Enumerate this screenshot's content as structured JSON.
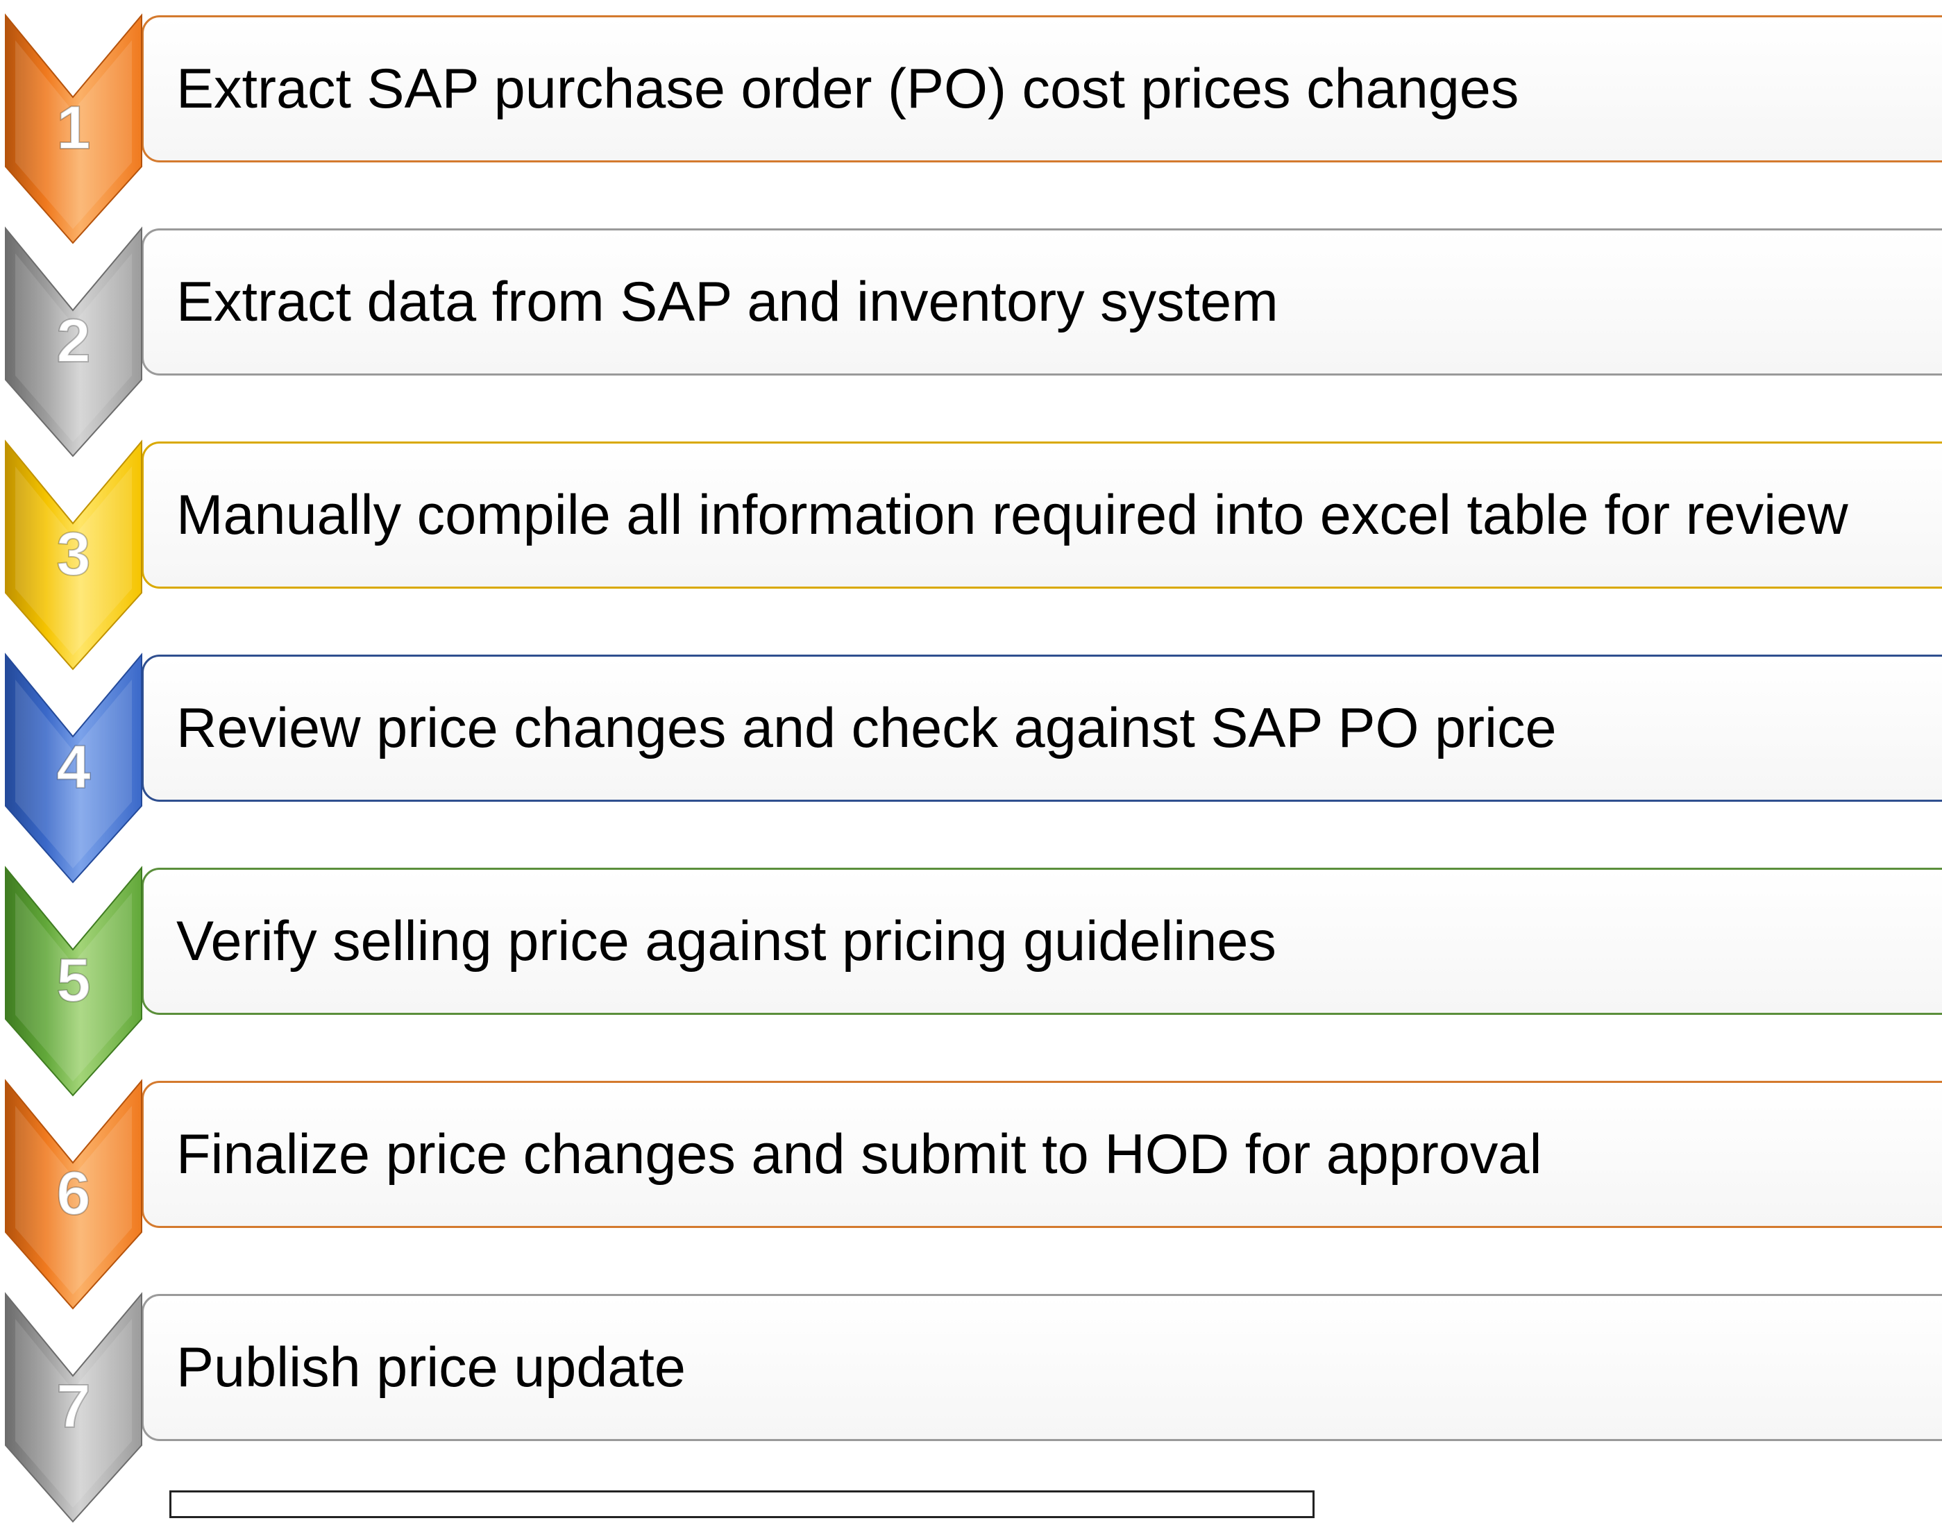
{
  "steps": [
    {
      "number": "1",
      "text": "Extract SAP purchase order (PO) cost prices changes",
      "color": "#f07a1f",
      "light": "#fbb067",
      "dark": "#b5530c",
      "border": "#d47a2e"
    },
    {
      "number": "2",
      "text": "Extract data from SAP and inventory system",
      "color": "#9c9c9c",
      "light": "#d2d2d2",
      "dark": "#6c6c6c",
      "border": "#9a9a9a"
    },
    {
      "number": "3",
      "text": "Manually compile all information required into excel table for review",
      "color": "#f5c400",
      "light": "#ffe566",
      "dark": "#c09200",
      "border": "#d9a900"
    },
    {
      "number": "4",
      "text": "Review price changes and check against SAP PO price",
      "color": "#3b69c9",
      "light": "#7ba2ea",
      "dark": "#244a9a",
      "border": "#2f4f8f"
    },
    {
      "number": "5",
      "text": "Verify selling price against pricing guidelines",
      "color": "#62a83a",
      "light": "#a2d477",
      "dark": "#3f7c21",
      "border": "#5b8f3b"
    },
    {
      "number": "6",
      "text": "Finalize price changes and submit to HOD for approval",
      "color": "#f07a1f",
      "light": "#fbb067",
      "dark": "#b5530c",
      "border": "#d47a2e"
    },
    {
      "number": "7",
      "text": "Publish price update",
      "color": "#9c9c9c",
      "light": "#d2d2d2",
      "dark": "#6c6c6c",
      "border": "#9a9a9a"
    }
  ]
}
